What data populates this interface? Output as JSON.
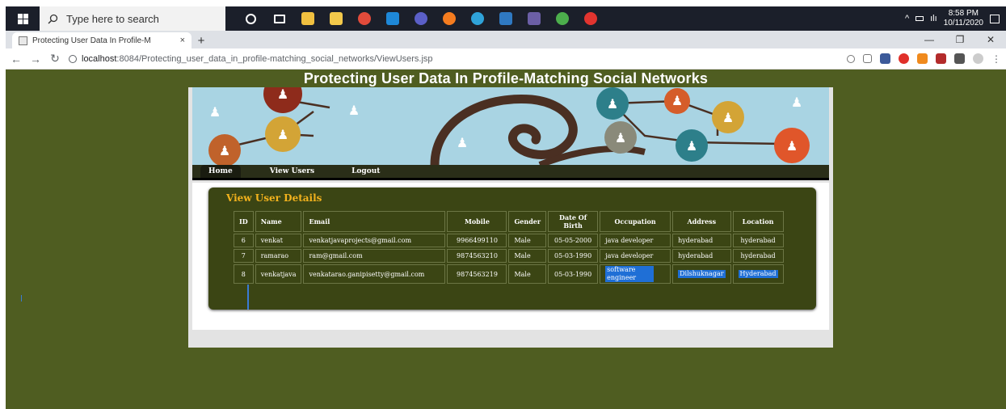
{
  "taskbar": {
    "search_placeholder": "Type here to search",
    "time": "8:58 PM",
    "date": "10/11/2020"
  },
  "browser": {
    "tab_title": "Protecting User Data In Profile-M",
    "tab_close": "×",
    "new_tab": "+",
    "url_host": "localhost",
    "url_rest": ":8084/Protecting_user_data_in_profile-matching_social_networks/ViewUsers.jsp",
    "window_controls": [
      "—",
      "❐",
      "✕"
    ]
  },
  "site": {
    "title": "Protecting User Data In Profile-Matching Social Networks",
    "nav": [
      {
        "label": "Home",
        "active": true
      },
      {
        "label": "View Users",
        "active": false
      },
      {
        "label": "Logout",
        "active": false
      }
    ]
  },
  "panel": {
    "title": "View User Details",
    "columns": [
      "ID",
      "Name",
      "Email",
      "Mobile",
      "Gender",
      "Date Of Birth",
      "Occupation",
      "Address",
      "Location"
    ],
    "rows": [
      [
        "6",
        "venkat",
        "venkatjavaprojects@gmail.com",
        "9966499110",
        "Male",
        "05-05-2000",
        "java developer",
        "hyderabad",
        "hyderabad"
      ],
      [
        "7",
        "ramarao",
        "ram@gmail.com",
        "9874563210",
        "Male",
        "05-03-1990",
        "java developer",
        "hyderabad",
        "hyderabad"
      ],
      [
        "8",
        "venkatjava",
        "venkatarao.ganipisetty@gmail.com",
        "9874563219",
        "Male",
        "05-03-1990",
        "software engineer",
        "Dilshuknagar",
        "Hyderabad"
      ]
    ]
  },
  "colors": {
    "page_bg": "#4f5d21",
    "panel_bg": "#3b4514",
    "panel_title": "#f2b21d",
    "selection": "#1f6fd6"
  }
}
